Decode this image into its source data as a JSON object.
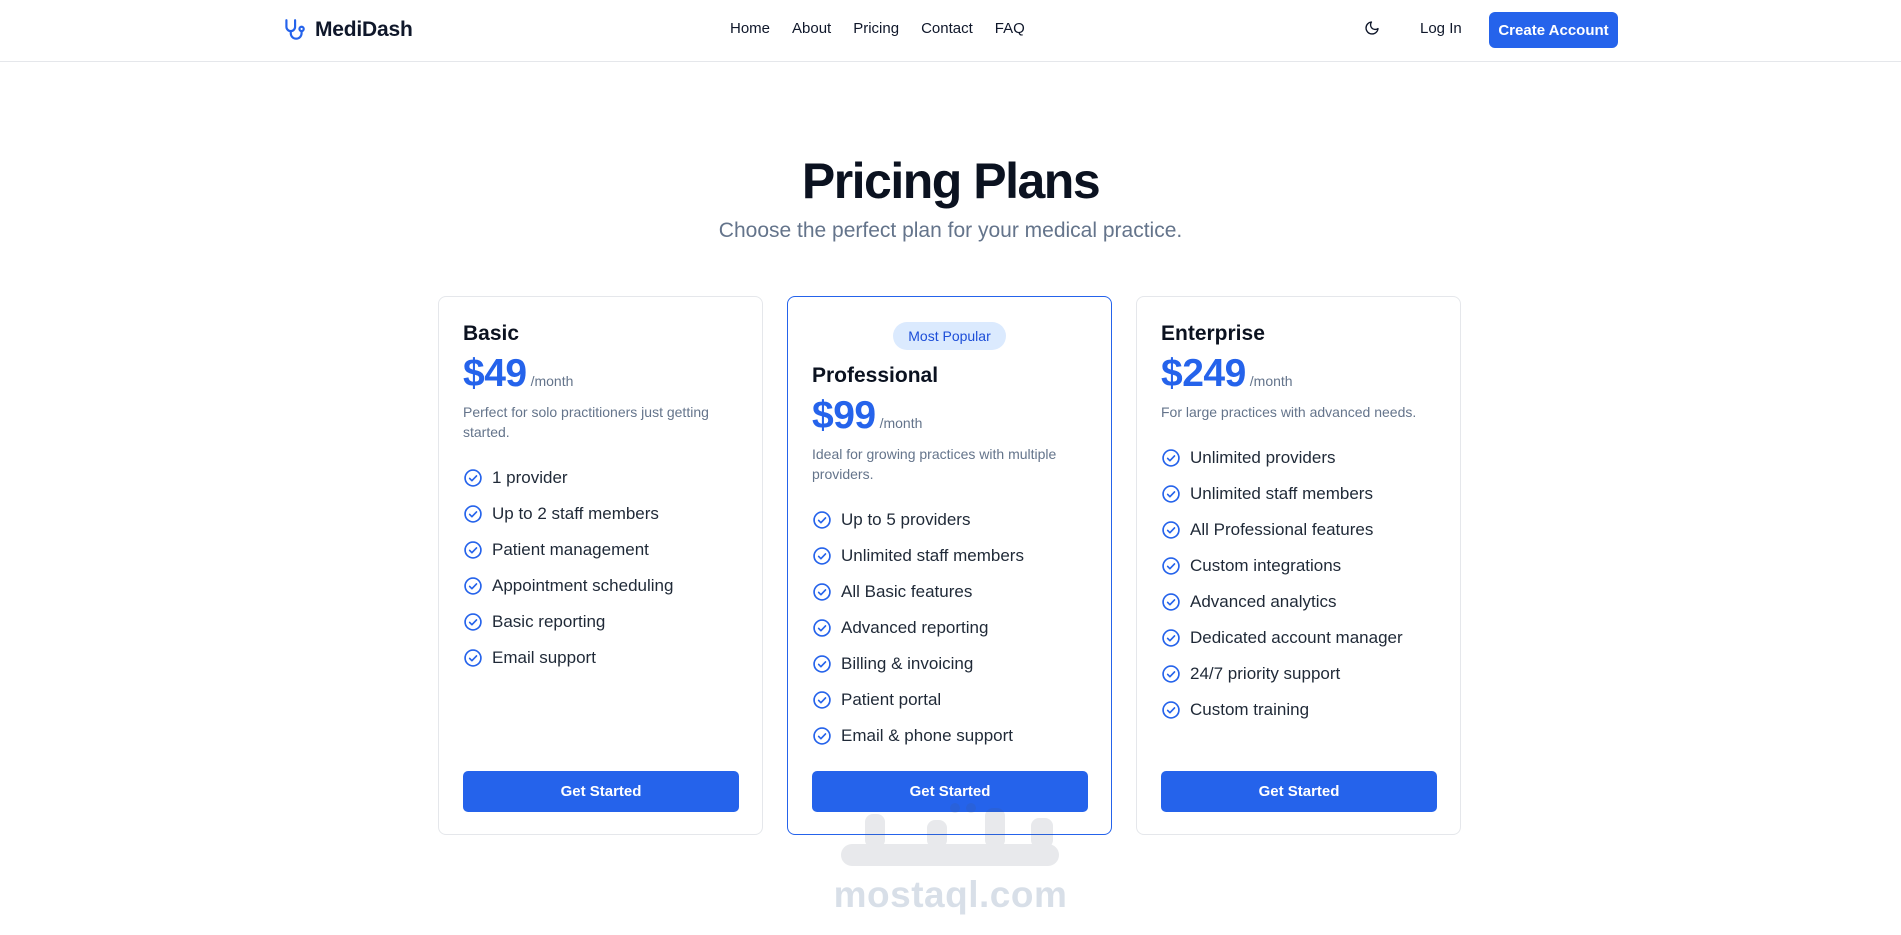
{
  "header": {
    "brand": "MediDash",
    "nav": [
      "Home",
      "About",
      "Pricing",
      "Contact",
      "FAQ"
    ],
    "login_label": "Log In",
    "create_label": "Create Account",
    "theme_icon": "moon-icon",
    "logo_icon": "stethoscope-icon"
  },
  "hero": {
    "title": "Pricing Plans",
    "subtitle": "Choose the perfect plan for your medical practice."
  },
  "plans": [
    {
      "name": "Basic",
      "price": "$49",
      "period": "/month",
      "description": "Perfect for solo practitioners just getting started.",
      "features": [
        "1 provider",
        "Up to 2 staff members",
        "Patient management",
        "Appointment scheduling",
        "Basic reporting",
        "Email support"
      ],
      "cta": "Get Started"
    },
    {
      "badge": "Most Popular",
      "name": "Professional",
      "price": "$99",
      "period": "/month",
      "description": "Ideal for growing practices with multiple providers.",
      "features": [
        "Up to 5 providers",
        "Unlimited staff members",
        "All Basic features",
        "Advanced reporting",
        "Billing & invoicing",
        "Patient portal",
        "Email & phone support"
      ],
      "cta": "Get Started"
    },
    {
      "name": "Enterprise",
      "price": "$249",
      "period": "/month",
      "description": "For large practices with advanced needs.",
      "features": [
        "Unlimited providers",
        "Unlimited staff members",
        "All Professional features",
        "Custom integrations",
        "Advanced analytics",
        "Dedicated account manager",
        "24/7 priority support",
        "Custom training"
      ],
      "cta": "Get Started"
    }
  ],
  "watermark": {
    "text": "mostaql.com"
  },
  "colors": {
    "accent": "#2563eb",
    "badge_bg": "#dbeafe",
    "muted": "#64748b"
  }
}
